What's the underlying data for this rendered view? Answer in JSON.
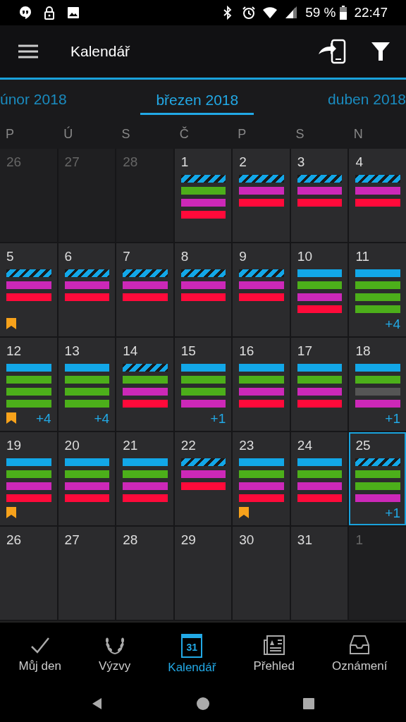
{
  "status_bar": {
    "battery_text": "59 %",
    "time": "22:47"
  },
  "app_bar": {
    "title": "Kalendář"
  },
  "months": [
    {
      "label": "únor 2018",
      "selected": false
    },
    {
      "label": "březen 2018",
      "selected": true
    },
    {
      "label": "duben 2018",
      "selected": false
    }
  ],
  "weekdays": [
    "P",
    "Ú",
    "S",
    "Č",
    "P",
    "S",
    "N"
  ],
  "days": [
    {
      "day": "26",
      "outside": true,
      "selected": false
    },
    {
      "day": "27",
      "outside": true,
      "selected": false
    },
    {
      "day": "28",
      "outside": true,
      "selected": false
    },
    {
      "day": "1",
      "outside": false,
      "selected": false,
      "events": [
        {
          "kind": "striped",
          "color": "#12a7e8"
        },
        {
          "kind": "solid",
          "color": "#4caf1a"
        },
        {
          "kind": "solid",
          "color": "#cc28b8"
        },
        {
          "kind": "solid",
          "color": "#ff0a3a"
        }
      ]
    },
    {
      "day": "2",
      "outside": false,
      "selected": false,
      "events": [
        {
          "kind": "striped",
          "color": "#12a7e8"
        },
        {
          "kind": "solid",
          "color": "#cc28b8"
        },
        {
          "kind": "solid",
          "color": "#ff0a3a"
        }
      ]
    },
    {
      "day": "3",
      "outside": false,
      "selected": false,
      "events": [
        {
          "kind": "striped",
          "color": "#12a7e8"
        },
        {
          "kind": "solid",
          "color": "#cc28b8"
        },
        {
          "kind": "solid",
          "color": "#ff0a3a"
        }
      ]
    },
    {
      "day": "4",
      "outside": false,
      "selected": false,
      "events": [
        {
          "kind": "striped",
          "color": "#12a7e8"
        },
        {
          "kind": "solid",
          "color": "#cc28b8"
        },
        {
          "kind": "solid",
          "color": "#ff0a3a"
        }
      ]
    },
    {
      "day": "5",
      "outside": false,
      "selected": false,
      "bookmark": true,
      "events": [
        {
          "kind": "striped",
          "color": "#12a7e8"
        },
        {
          "kind": "solid",
          "color": "#cc28b8"
        },
        {
          "kind": "solid",
          "color": "#ff0a3a"
        }
      ]
    },
    {
      "day": "6",
      "outside": false,
      "selected": false,
      "events": [
        {
          "kind": "striped",
          "color": "#12a7e8"
        },
        {
          "kind": "solid",
          "color": "#cc28b8"
        },
        {
          "kind": "solid",
          "color": "#ff0a3a"
        }
      ]
    },
    {
      "day": "7",
      "outside": false,
      "selected": false,
      "events": [
        {
          "kind": "striped",
          "color": "#12a7e8"
        },
        {
          "kind": "solid",
          "color": "#cc28b8"
        },
        {
          "kind": "solid",
          "color": "#ff0a3a"
        }
      ]
    },
    {
      "day": "8",
      "outside": false,
      "selected": false,
      "events": [
        {
          "kind": "striped",
          "color": "#12a7e8"
        },
        {
          "kind": "solid",
          "color": "#cc28b8"
        },
        {
          "kind": "solid",
          "color": "#ff0a3a"
        }
      ]
    },
    {
      "day": "9",
      "outside": false,
      "selected": false,
      "events": [
        {
          "kind": "striped",
          "color": "#12a7e8"
        },
        {
          "kind": "solid",
          "color": "#cc28b8"
        },
        {
          "kind": "solid",
          "color": "#ff0a3a"
        }
      ]
    },
    {
      "day": "10",
      "outside": false,
      "selected": false,
      "events": [
        {
          "kind": "solid",
          "color": "#12a7e8"
        },
        {
          "kind": "solid",
          "color": "#4caf1a"
        },
        {
          "kind": "solid",
          "color": "#cc28b8"
        },
        {
          "kind": "solid",
          "color": "#ff0a3a"
        }
      ]
    },
    {
      "day": "11",
      "outside": false,
      "selected": false,
      "more": "+4",
      "events": [
        {
          "kind": "solid",
          "color": "#12a7e8"
        },
        {
          "kind": "solid",
          "color": "#4caf1a"
        },
        {
          "kind": "solid",
          "color": "#4caf1a"
        },
        {
          "kind": "solid",
          "color": "#4caf1a"
        }
      ]
    },
    {
      "day": "12",
      "outside": false,
      "selected": false,
      "bookmark": true,
      "more": "+4",
      "events": [
        {
          "kind": "solid",
          "color": "#12a7e8"
        },
        {
          "kind": "solid",
          "color": "#4caf1a"
        },
        {
          "kind": "solid",
          "color": "#4caf1a"
        },
        {
          "kind": "solid",
          "color": "#4caf1a"
        }
      ]
    },
    {
      "day": "13",
      "outside": false,
      "selected": false,
      "more": "+4",
      "events": [
        {
          "kind": "solid",
          "color": "#12a7e8"
        },
        {
          "kind": "solid",
          "color": "#4caf1a"
        },
        {
          "kind": "solid",
          "color": "#4caf1a"
        },
        {
          "kind": "solid",
          "color": "#4caf1a"
        }
      ]
    },
    {
      "day": "14",
      "outside": false,
      "selected": false,
      "events": [
        {
          "kind": "striped",
          "color": "#12a7e8"
        },
        {
          "kind": "solid",
          "color": "#4caf1a"
        },
        {
          "kind": "solid",
          "color": "#cc28b8"
        },
        {
          "kind": "solid",
          "color": "#ff0a3a"
        }
      ]
    },
    {
      "day": "15",
      "outside": false,
      "selected": false,
      "more": "+1",
      "events": [
        {
          "kind": "solid",
          "color": "#12a7e8"
        },
        {
          "kind": "solid",
          "color": "#4caf1a"
        },
        {
          "kind": "solid",
          "color": "#4caf1a"
        },
        {
          "kind": "solid",
          "color": "#cc28b8"
        }
      ]
    },
    {
      "day": "16",
      "outside": false,
      "selected": false,
      "events": [
        {
          "kind": "solid",
          "color": "#12a7e8"
        },
        {
          "kind": "solid",
          "color": "#4caf1a"
        },
        {
          "kind": "solid",
          "color": "#cc28b8"
        },
        {
          "kind": "solid",
          "color": "#ff0a3a"
        }
      ]
    },
    {
      "day": "17",
      "outside": false,
      "selected": false,
      "events": [
        {
          "kind": "solid",
          "color": "#12a7e8"
        },
        {
          "kind": "solid",
          "color": "#4caf1a"
        },
        {
          "kind": "solid",
          "color": "#cc28b8"
        },
        {
          "kind": "solid",
          "color": "#ff0a3a"
        }
      ]
    },
    {
      "day": "18",
      "outside": false,
      "selected": false,
      "more": "+1",
      "events": [
        {
          "kind": "solid",
          "color": "#12a7e8"
        },
        {
          "kind": "solid",
          "color": "#4caf1a"
        },
        {
          "kind": "solid",
          "color": "#555555"
        },
        {
          "kind": "solid",
          "color": "#cc28b8"
        }
      ]
    },
    {
      "day": "19",
      "outside": false,
      "selected": false,
      "bookmark": true,
      "events": [
        {
          "kind": "solid",
          "color": "#12a7e8"
        },
        {
          "kind": "solid",
          "color": "#4caf1a"
        },
        {
          "kind": "solid",
          "color": "#cc28b8"
        },
        {
          "kind": "solid",
          "color": "#ff0a3a"
        }
      ]
    },
    {
      "day": "20",
      "outside": false,
      "selected": false,
      "events": [
        {
          "kind": "solid",
          "color": "#12a7e8"
        },
        {
          "kind": "solid",
          "color": "#4caf1a"
        },
        {
          "kind": "solid",
          "color": "#cc28b8"
        },
        {
          "kind": "solid",
          "color": "#ff0a3a"
        }
      ]
    },
    {
      "day": "21",
      "outside": false,
      "selected": false,
      "events": [
        {
          "kind": "solid",
          "color": "#12a7e8"
        },
        {
          "kind": "solid",
          "color": "#4caf1a"
        },
        {
          "kind": "solid",
          "color": "#cc28b8"
        },
        {
          "kind": "solid",
          "color": "#ff0a3a"
        }
      ]
    },
    {
      "day": "22",
      "outside": false,
      "selected": false,
      "events": [
        {
          "kind": "striped",
          "color": "#12a7e8"
        },
        {
          "kind": "solid",
          "color": "#cc28b8"
        },
        {
          "kind": "solid",
          "color": "#ff0a3a"
        }
      ]
    },
    {
      "day": "23",
      "outside": false,
      "selected": false,
      "bookmark": true,
      "events": [
        {
          "kind": "solid",
          "color": "#12a7e8"
        },
        {
          "kind": "solid",
          "color": "#4caf1a"
        },
        {
          "kind": "solid",
          "color": "#cc28b8"
        },
        {
          "kind": "solid",
          "color": "#ff0a3a"
        }
      ]
    },
    {
      "day": "24",
      "outside": false,
      "selected": false,
      "events": [
        {
          "kind": "solid",
          "color": "#12a7e8"
        },
        {
          "kind": "solid",
          "color": "#4caf1a"
        },
        {
          "kind": "solid",
          "color": "#cc28b8"
        },
        {
          "kind": "solid",
          "color": "#ff0a3a"
        }
      ]
    },
    {
      "day": "25",
      "outside": false,
      "selected": true,
      "more": "+1",
      "events": [
        {
          "kind": "striped",
          "color": "#12a7e8"
        },
        {
          "kind": "solid",
          "color": "#4caf1a"
        },
        {
          "kind": "solid",
          "color": "#4caf1a"
        },
        {
          "kind": "solid",
          "color": "#cc28b8"
        }
      ]
    },
    {
      "day": "26",
      "outside": false,
      "selected": false
    },
    {
      "day": "27",
      "outside": false,
      "selected": false
    },
    {
      "day": "28",
      "outside": false,
      "selected": false
    },
    {
      "day": "29",
      "outside": false,
      "selected": false
    },
    {
      "day": "30",
      "outside": false,
      "selected": false
    },
    {
      "day": "31",
      "outside": false,
      "selected": false
    },
    {
      "day": "1",
      "outside": true,
      "selected": false
    }
  ],
  "bottom_nav": [
    {
      "kind": "check",
      "label": "Můj den",
      "selected": false
    },
    {
      "kind": "laurel",
      "label": "Výzvy",
      "selected": false
    },
    {
      "kind": "calendar",
      "label": "Kalendář",
      "icon_text": "31",
      "selected": true
    },
    {
      "kind": "news",
      "label": "Přehled",
      "selected": false
    },
    {
      "kind": "inbox",
      "label": "Oznámení",
      "selected": false
    }
  ]
}
